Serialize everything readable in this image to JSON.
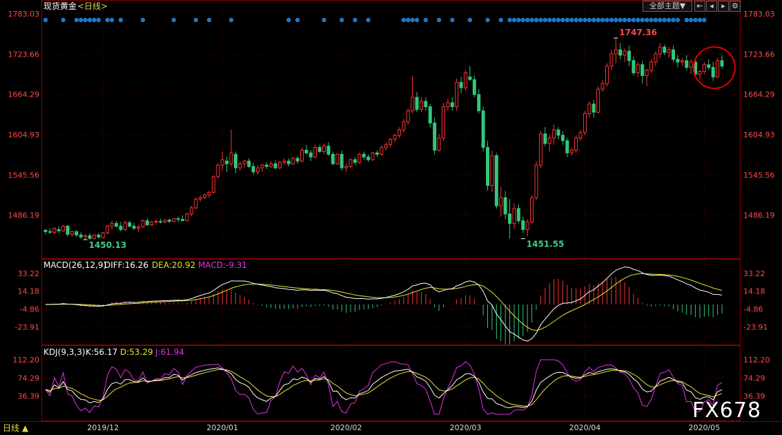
{
  "header": {
    "instrument": "现货黄金",
    "period": "<日线>",
    "theme_button": "全部主题▼",
    "nav_icons": [
      "first-page-icon",
      "prev-page-icon",
      "next-page-icon",
      "settings-icon"
    ]
  },
  "watermark": "FX678",
  "footer": {
    "period_tab": "日线 ▲"
  },
  "colors": {
    "up": "#ff3232",
    "down": "#32c87a",
    "diff": "#ffffff",
    "dea": "#e6e632",
    "k": "#ffffff",
    "d": "#e6e632",
    "j": "#e632e6",
    "dots": "#1e78c8",
    "circle": "#e00000"
  },
  "chart_data": [
    {
      "type": "candlestick",
      "title": "现货黄金",
      "y_ticks": [
        "1783.03",
        "1723.66",
        "1664.29",
        "1604.93",
        "1545.56",
        "1486.19"
      ],
      "ylim": [
        1426.8,
        1783.03
      ],
      "x_ticks": [
        "2019/12",
        "2020/01",
        "2020/02",
        "2020/03",
        "2020/04",
        "2020/05"
      ],
      "x_tick_index": [
        13,
        40,
        68,
        95,
        122,
        149
      ],
      "annotations": [
        {
          "label": "1747.36",
          "index": 129,
          "value": 1747.36,
          "color": "#ff4a4a"
        },
        {
          "label": "1450.13",
          "index": 9,
          "value": 1450.13,
          "color": "#3cd08a"
        },
        {
          "label": "1451.55",
          "index": 108,
          "value": 1451.55,
          "color": "#3cd08a"
        }
      ],
      "ohlc": [
        [
          1464,
          1466,
          1458,
          1462
        ],
        [
          1462,
          1467,
          1459,
          1461
        ],
        [
          1461,
          1468,
          1458,
          1467
        ],
        [
          1465,
          1470,
          1460,
          1463
        ],
        [
          1463,
          1471,
          1462,
          1470
        ],
        [
          1470,
          1472,
          1455,
          1458
        ],
        [
          1458,
          1463,
          1455,
          1462
        ],
        [
          1462,
          1464,
          1454,
          1457
        ],
        [
          1457,
          1461,
          1451,
          1454
        ],
        [
          1454,
          1458,
          1450.13,
          1456
        ],
        [
          1456,
          1460,
          1450,
          1452
        ],
        [
          1452,
          1458,
          1450,
          1457
        ],
        [
          1457,
          1460,
          1452,
          1454
        ],
        [
          1453,
          1462,
          1452,
          1460
        ],
        [
          1460,
          1472,
          1458,
          1470
        ],
        [
          1470,
          1478,
          1465,
          1474
        ],
        [
          1474,
          1478,
          1468,
          1470
        ],
        [
          1470,
          1476,
          1462,
          1465
        ],
        [
          1465,
          1478,
          1463,
          1475
        ],
        [
          1475,
          1478,
          1468,
          1470
        ],
        [
          1470,
          1475,
          1464,
          1467
        ],
        [
          1467,
          1472,
          1462,
          1469
        ],
        [
          1469,
          1480,
          1467,
          1478
        ],
        [
          1478,
          1482,
          1470,
          1472
        ],
        [
          1472,
          1478,
          1470,
          1476
        ],
        [
          1476,
          1480,
          1472,
          1477
        ],
        [
          1477,
          1481,
          1474,
          1476
        ],
        [
          1476,
          1480,
          1474,
          1479
        ],
        [
          1479,
          1481,
          1475,
          1477
        ],
        [
          1477,
          1482,
          1476,
          1481
        ],
        [
          1481,
          1484,
          1476,
          1480
        ],
        [
          1480,
          1486,
          1478,
          1478
        ],
        [
          1478,
          1490,
          1477,
          1488
        ],
        [
          1488,
          1500,
          1485,
          1497
        ],
        [
          1497,
          1512,
          1495,
          1510
        ],
        [
          1510,
          1515,
          1506,
          1512
        ],
        [
          1512,
          1518,
          1510,
          1516
        ],
        [
          1516,
          1522,
          1512,
          1520
        ],
        [
          1520,
          1545,
          1518,
          1543
        ],
        [
          1543,
          1562,
          1540,
          1560
        ],
        [
          1560,
          1580,
          1552,
          1568
        ],
        [
          1566,
          1572,
          1550,
          1562
        ],
        [
          1562,
          1612,
          1558,
          1578
        ],
        [
          1576,
          1580,
          1548,
          1556
        ],
        [
          1556,
          1566,
          1552,
          1562
        ],
        [
          1562,
          1568,
          1556,
          1566
        ],
        [
          1566,
          1570,
          1556,
          1558
        ],
        [
          1558,
          1564,
          1546,
          1550
        ],
        [
          1550,
          1560,
          1546,
          1556
        ],
        [
          1556,
          1562,
          1550,
          1560
        ],
        [
          1560,
          1564,
          1554,
          1558
        ],
        [
          1558,
          1566,
          1556,
          1562
        ],
        [
          1562,
          1567,
          1554,
          1556
        ],
        [
          1556,
          1566,
          1554,
          1564
        ],
        [
          1564,
          1570,
          1560,
          1566
        ],
        [
          1566,
          1570,
          1558,
          1562
        ],
        [
          1562,
          1572,
          1560,
          1570
        ],
        [
          1570,
          1574,
          1562,
          1566
        ],
        [
          1566,
          1586,
          1564,
          1582
        ],
        [
          1582,
          1590,
          1575,
          1578
        ],
        [
          1578,
          1582,
          1566,
          1572
        ],
        [
          1572,
          1590,
          1570,
          1586
        ],
        [
          1586,
          1590,
          1578,
          1580
        ],
        [
          1580,
          1592,
          1576,
          1588
        ],
        [
          1588,
          1594,
          1574,
          1576
        ],
        [
          1576,
          1580,
          1560,
          1562
        ],
        [
          1562,
          1578,
          1560,
          1576
        ],
        [
          1576,
          1582,
          1552,
          1556
        ],
        [
          1556,
          1562,
          1550,
          1558
        ],
        [
          1558,
          1570,
          1556,
          1568
        ],
        [
          1568,
          1572,
          1560,
          1564
        ],
        [
          1564,
          1578,
          1562,
          1576
        ],
        [
          1576,
          1580,
          1568,
          1572
        ],
        [
          1572,
          1576,
          1564,
          1568
        ],
        [
          1568,
          1580,
          1566,
          1578
        ],
        [
          1578,
          1582,
          1572,
          1576
        ],
        [
          1576,
          1590,
          1574,
          1586
        ],
        [
          1586,
          1594,
          1582,
          1590
        ],
        [
          1590,
          1600,
          1586,
          1598
        ],
        [
          1598,
          1606,
          1594,
          1604
        ],
        [
          1604,
          1616,
          1600,
          1612
        ],
        [
          1612,
          1628,
          1608,
          1624
        ],
        [
          1624,
          1644,
          1620,
          1640
        ],
        [
          1640,
          1692,
          1636,
          1660
        ],
        [
          1660,
          1668,
          1638,
          1642
        ],
        [
          1642,
          1660,
          1638,
          1654
        ],
        [
          1654,
          1660,
          1640,
          1646
        ],
        [
          1646,
          1650,
          1616,
          1622
        ],
        [
          1622,
          1630,
          1576,
          1582
        ],
        [
          1582,
          1606,
          1580,
          1600
        ],
        [
          1600,
          1652,
          1596,
          1646
        ],
        [
          1646,
          1658,
          1640,
          1652
        ],
        [
          1652,
          1660,
          1640,
          1646
        ],
        [
          1646,
          1688,
          1640,
          1682
        ],
        [
          1682,
          1690,
          1666,
          1674
        ],
        [
          1674,
          1700,
          1670,
          1696
        ],
        [
          1690,
          1706,
          1684,
          1686
        ],
        [
          1686,
          1692,
          1660,
          1664
        ],
        [
          1664,
          1672,
          1636,
          1640
        ],
        [
          1640,
          1646,
          1580,
          1586
        ],
        [
          1586,
          1596,
          1522,
          1530
        ],
        [
          1530,
          1582,
          1520,
          1574
        ],
        [
          1574,
          1578,
          1496,
          1500
        ],
        [
          1500,
          1528,
          1484,
          1512
        ],
        [
          1512,
          1522,
          1480,
          1488
        ],
        [
          1488,
          1510,
          1451.55,
          1474
        ],
        [
          1474,
          1504,
          1466,
          1496
        ],
        [
          1496,
          1502,
          1474,
          1478
        ],
        [
          1478,
          1484,
          1460,
          1465
        ],
        [
          1465,
          1480,
          1455,
          1476
        ],
        [
          1476,
          1516,
          1474,
          1512
        ],
        [
          1512,
          1566,
          1508,
          1560
        ],
        [
          1560,
          1610,
          1556,
          1606
        ],
        [
          1606,
          1616,
          1588,
          1592
        ],
        [
          1592,
          1604,
          1580,
          1600
        ],
        [
          1600,
          1620,
          1590,
          1612
        ],
        [
          1612,
          1616,
          1598,
          1604
        ],
        [
          1604,
          1610,
          1590,
          1596
        ],
        [
          1596,
          1600,
          1572,
          1578
        ],
        [
          1578,
          1586,
          1574,
          1582
        ],
        [
          1582,
          1604,
          1578,
          1600
        ],
        [
          1600,
          1612,
          1596,
          1608
        ],
        [
          1608,
          1640,
          1604,
          1636
        ],
        [
          1636,
          1654,
          1630,
          1650
        ],
        [
          1650,
          1656,
          1630,
          1638
        ],
        [
          1638,
          1676,
          1636,
          1672
        ],
        [
          1672,
          1686,
          1668,
          1680
        ],
        [
          1680,
          1710,
          1676,
          1706
        ],
        [
          1706,
          1730,
          1700,
          1724
        ],
        [
          1724,
          1747.36,
          1710,
          1730
        ],
        [
          1730,
          1740,
          1716,
          1722
        ],
        [
          1722,
          1732,
          1712,
          1728
        ],
        [
          1728,
          1736,
          1706,
          1714
        ],
        [
          1714,
          1720,
          1692,
          1696
        ],
        [
          1696,
          1712,
          1690,
          1708
        ],
        [
          1708,
          1714,
          1680,
          1692
        ],
        [
          1692,
          1702,
          1676,
          1700
        ],
        [
          1700,
          1716,
          1696,
          1712
        ],
        [
          1712,
          1728,
          1706,
          1724
        ],
        [
          1724,
          1740,
          1718,
          1734
        ],
        [
          1734,
          1738,
          1722,
          1726
        ],
        [
          1726,
          1734,
          1718,
          1730
        ],
        [
          1730,
          1736,
          1712,
          1716
        ],
        [
          1716,
          1722,
          1704,
          1712
        ],
        [
          1712,
          1718,
          1706,
          1714
        ],
        [
          1714,
          1722,
          1700,
          1704
        ],
        [
          1704,
          1716,
          1694,
          1712
        ],
        [
          1712,
          1718,
          1690,
          1694
        ],
        [
          1694,
          1700,
          1686,
          1698
        ],
        [
          1698,
          1712,
          1694,
          1708
        ],
        [
          1708,
          1716,
          1700,
          1704
        ],
        [
          1704,
          1712,
          1684,
          1690
        ],
        [
          1690,
          1718,
          1688,
          1714
        ],
        [
          1714,
          1722,
          1702,
          1706
        ]
      ]
    },
    {
      "type": "line",
      "title": "MACD(26,12,9)",
      "readout": {
        "diff_label": "DIFF:16.26",
        "dea_label": "DEA:20.92",
        "macd_label": "MACD:-9.31"
      },
      "series_names": [
        "DIFF",
        "DEA",
        "MACD"
      ],
      "y_ticks": [
        "33.22",
        "14.18",
        "-4.86",
        "-23.91"
      ],
      "ylim": [
        -42.95,
        33.22
      ]
    },
    {
      "type": "line",
      "title": "KDJ(9,3,3)",
      "readout": {
        "k_label": "K:56.17",
        "d_label": "D:53.29",
        "j_label": "J:61.94"
      },
      "series_names": [
        "K",
        "D",
        "J"
      ],
      "y_ticks": [
        "112.20",
        "74.29",
        "36.39"
      ],
      "ylim": [
        -1.5,
        112.2
      ]
    }
  ]
}
